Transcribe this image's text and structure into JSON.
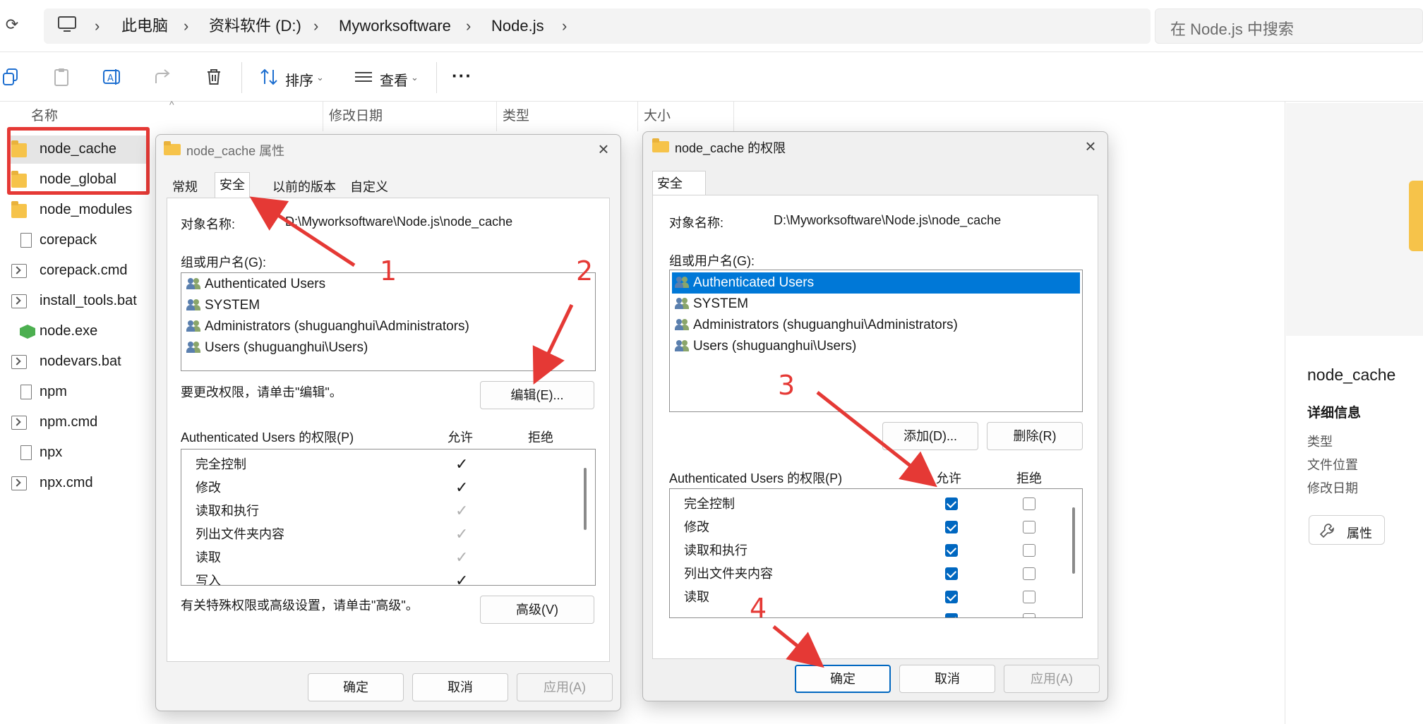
{
  "explorer": {
    "breadcrumbs": [
      "此电脑",
      "资料软件 (D:)",
      "Myworksoftware",
      "Node.js"
    ],
    "search_placeholder": "在 Node.js 中搜索",
    "toolbar": {
      "sort_label": "排序",
      "view_label": "查看"
    },
    "columns": {
      "name": "名称",
      "modified": "修改日期",
      "type": "类型",
      "size": "大小"
    },
    "files": [
      {
        "name": "node_cache",
        "icon": "folder-icon"
      },
      {
        "name": "node_global",
        "icon": "folder-icon"
      },
      {
        "name": "node_modules",
        "icon": "folder-icon"
      },
      {
        "name": "corepack",
        "icon": "file-icon"
      },
      {
        "name": "corepack.cmd",
        "icon": "script-icon"
      },
      {
        "name": "install_tools.bat",
        "icon": "script-icon"
      },
      {
        "name": "node.exe",
        "icon": "node-icon"
      },
      {
        "name": "nodevars.bat",
        "icon": "script-icon"
      },
      {
        "name": "npm",
        "icon": "file-icon"
      },
      {
        "name": "npm.cmd",
        "icon": "script-icon"
      },
      {
        "name": "npx",
        "icon": "file-icon"
      },
      {
        "name": "npx.cmd",
        "icon": "script-icon"
      }
    ]
  },
  "details_pane": {
    "name": "node_cache",
    "heading": "详细信息",
    "fields": [
      "类型",
      "文件位置",
      "修改日期"
    ],
    "properties_button": "属性"
  },
  "properties_dialog": {
    "title": "node_cache 属性",
    "tabs": [
      "常规",
      "安全",
      "以前的版本",
      "自定义"
    ],
    "object_label": "对象名称:",
    "object_value": "D:\\Myworksoftware\\Node.js\\node_cache",
    "group_label": "组或用户名(G):",
    "users": [
      "Authenticated Users",
      "SYSTEM",
      "Administrators (shuguanghui\\Administrators)",
      "Users (shuguanghui\\Users)"
    ],
    "edit_hint": "要更改权限，请单击\"编辑\"。",
    "edit_button": "编辑(E)...",
    "perm_header": "Authenticated Users 的权限(P)",
    "allow_label": "允许",
    "deny_label": "拒绝",
    "permissions": [
      "完全控制",
      "修改",
      "读取和执行",
      "列出文件夹内容",
      "读取",
      "写入"
    ],
    "advanced_hint": "有关特殊权限或高级设置，请单击\"高级\"。",
    "advanced_button": "高级(V)",
    "ok_button": "确定",
    "cancel_button": "取消",
    "apply_button": "应用(A)"
  },
  "permissions_dialog": {
    "title": "node_cache 的权限",
    "tab": "安全",
    "object_label": "对象名称:",
    "object_value": "D:\\Myworksoftware\\Node.js\\node_cache",
    "group_label": "组或用户名(G):",
    "users": [
      "Authenticated Users",
      "SYSTEM",
      "Administrators (shuguanghui\\Administrators)",
      "Users (shuguanghui\\Users)"
    ],
    "add_button": "添加(D)...",
    "remove_button": "删除(R)",
    "perm_header": "Authenticated Users 的权限(P)",
    "allow_label": "允许",
    "deny_label": "拒绝",
    "permissions": [
      "完全控制",
      "修改",
      "读取和执行",
      "列出文件夹内容",
      "读取"
    ],
    "ok_button": "确定",
    "cancel_button": "取消",
    "apply_button": "应用(A)"
  },
  "annotations": [
    "1",
    "2",
    "3",
    "4"
  ],
  "colors": {
    "annotation": "#e53935",
    "accent": "#0067c0",
    "selection": "#0078d7"
  }
}
